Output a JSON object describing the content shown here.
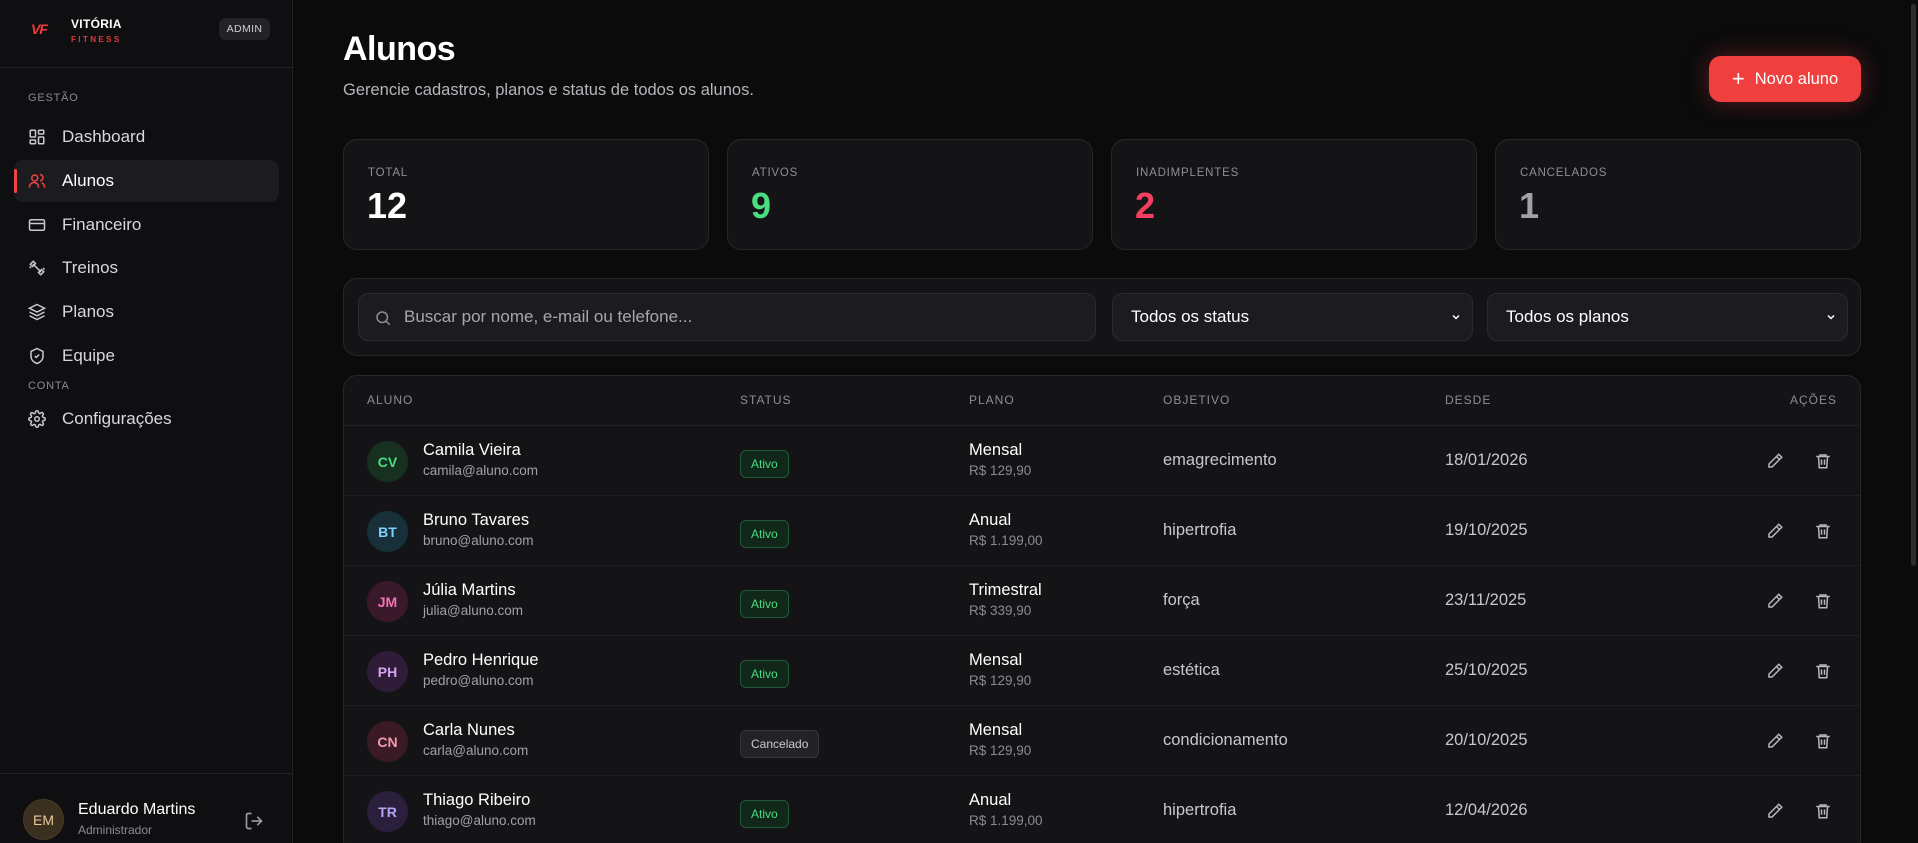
{
  "brand": {
    "logo": "VF",
    "name": "VITÓRIA",
    "sub": "FITNESS",
    "badge": "ADMIN"
  },
  "sidebar": {
    "section_gestao": "GESTÃO",
    "section_conta": "CONTA",
    "items": [
      {
        "label": "Dashboard",
        "icon": "dashboard-icon"
      },
      {
        "label": "Alunos",
        "icon": "users-icon",
        "active": true
      },
      {
        "label": "Financeiro",
        "icon": "credit-card-icon"
      },
      {
        "label": "Treinos",
        "icon": "dumbbell-icon"
      },
      {
        "label": "Planos",
        "icon": "layers-icon"
      },
      {
        "label": "Equipe",
        "icon": "shield-icon"
      }
    ],
    "config_item": {
      "label": "Configurações",
      "icon": "gear-icon"
    }
  },
  "user": {
    "initials": "EM",
    "name": "Eduardo Martins",
    "role": "Administrador"
  },
  "header": {
    "title": "Alunos",
    "subtitle": "Gerencie cadastros, planos e status de todos os alunos.",
    "new_button": "Novo aluno"
  },
  "stats": [
    {
      "label": "TOTAL",
      "value": "12",
      "color": "#ffffff"
    },
    {
      "label": "ATIVOS",
      "value": "9",
      "color": "#4ade80"
    },
    {
      "label": "INADIMPLENTES",
      "value": "2",
      "color": "#f43f5e"
    },
    {
      "label": "CANCELADOS",
      "value": "1",
      "color": "#a1a1aa"
    }
  ],
  "filters": {
    "search_placeholder": "Buscar por nome, e-mail ou telefone...",
    "status_select": "Todos os status",
    "plan_select": "Todos os planos"
  },
  "table": {
    "headers": {
      "aluno": "ALUNO",
      "status": "STATUS",
      "plano": "PLANO",
      "objetivo": "OBJETIVO",
      "desde": "DESDE",
      "acoes": "AÇÕES"
    },
    "rows": [
      {
        "initials": "CV",
        "name": "Camila Vieira",
        "email": "camila@aluno.com",
        "status": "Ativo",
        "plan": "Mensal",
        "price": "R$ 129,90",
        "goal": "emagrecimento",
        "since": "18/01/2026",
        "avatar_bg": "#17301f",
        "avatar_fg": "#4ade80"
      },
      {
        "initials": "BT",
        "name": "Bruno Tavares",
        "email": "bruno@aluno.com",
        "status": "Ativo",
        "plan": "Anual",
        "price": "R$ 1.199,00",
        "goal": "hipertrofia",
        "since": "19/10/2025",
        "avatar_bg": "#17303a",
        "avatar_fg": "#7dd3fc"
      },
      {
        "initials": "JM",
        "name": "Júlia Martins",
        "email": "julia@aluno.com",
        "status": "Ativo",
        "plan": "Trimestral",
        "price": "R$ 339,90",
        "goal": "força",
        "since": "23/11/2025",
        "avatar_bg": "#3a1a2a",
        "avatar_fg": "#f472b6"
      },
      {
        "initials": "PH",
        "name": "Pedro Henrique",
        "email": "pedro@aluno.com",
        "status": "Ativo",
        "plan": "Mensal",
        "price": "R$ 129,90",
        "goal": "estética",
        "since": "25/10/2025",
        "avatar_bg": "#2e1c38",
        "avatar_fg": "#d8a4f0"
      },
      {
        "initials": "CN",
        "name": "Carla Nunes",
        "email": "carla@aluno.com",
        "status": "Cancelado",
        "plan": "Mensal",
        "price": "R$ 129,90",
        "goal": "condicionamento",
        "since": "20/10/2025",
        "avatar_bg": "#3a1a24",
        "avatar_fg": "#f29bb0"
      },
      {
        "initials": "TR",
        "name": "Thiago Ribeiro",
        "email": "thiago@aluno.com",
        "status": "Ativo",
        "plan": "Anual",
        "price": "R$ 1.199,00",
        "goal": "hipertrofia",
        "since": "12/04/2026",
        "avatar_bg": "#2a1f3d",
        "avatar_fg": "#b7a4f5"
      }
    ]
  }
}
